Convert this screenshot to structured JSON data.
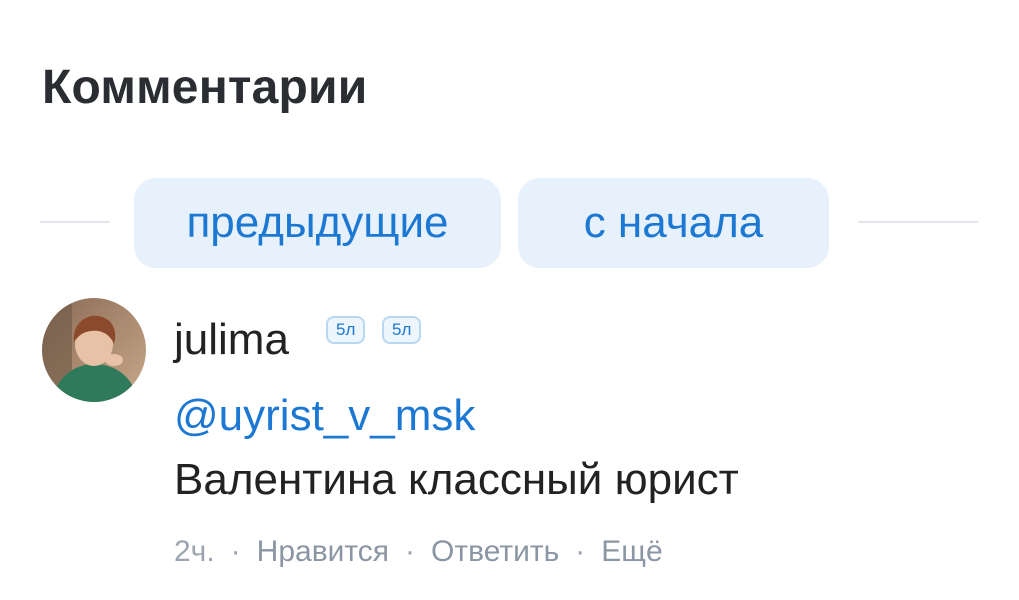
{
  "comments_section": {
    "title": "Комментарии",
    "load_previous_label": "предыдущие",
    "load_from_start_label": "с начала"
  },
  "comment": {
    "author": "julima",
    "badges": [
      "5л",
      "5л"
    ],
    "avatar_icon": "user-photo-avatar",
    "mention": "@uyrist_v_msk",
    "text": "Валентина классный юрист",
    "time": "2ч.",
    "separator": "·",
    "like_label": "Нравится",
    "reply_label": "Ответить",
    "more_label": "Ещё"
  },
  "colors": {
    "accent": "#1c78d2",
    "pill_background": "#e6f1fc",
    "meta_text": "#9aa4b0",
    "title_text": "#2a2d31"
  }
}
